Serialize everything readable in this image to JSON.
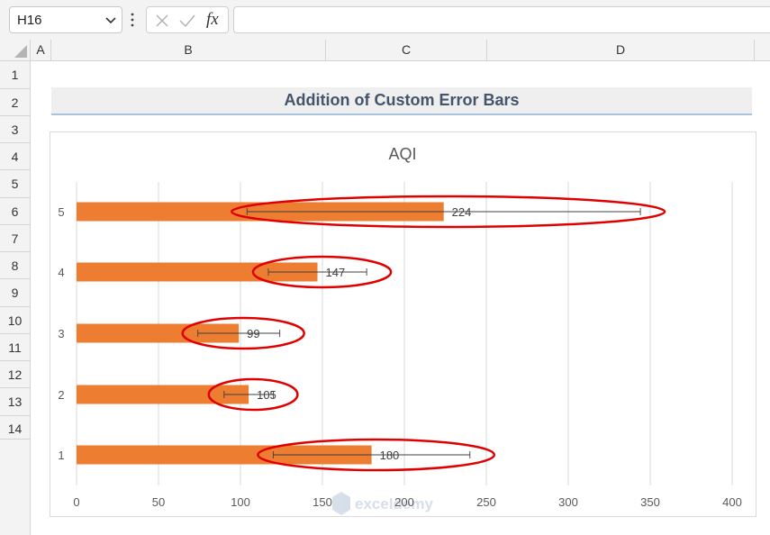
{
  "formula_bar": {
    "name_box": "H16",
    "formula": "",
    "cancel_icon": "x-icon",
    "enter_icon": "check-icon",
    "fx_label": "fx"
  },
  "columns": [
    "A",
    "B",
    "C",
    "D"
  ],
  "rows": [
    "1",
    "2",
    "3",
    "4",
    "5",
    "6",
    "7",
    "8",
    "9",
    "10",
    "11",
    "12",
    "13",
    "14"
  ],
  "sheet": {
    "title": "Addition of Custom Error Bars"
  },
  "colors": {
    "bar": "#ed7d31",
    "highlight": "#e00000",
    "gridline": "#d9d9d9",
    "title_text": "#44546a"
  },
  "chart_data": {
    "type": "bar",
    "orientation": "horizontal",
    "title": "AQI",
    "categories": [
      "1",
      "2",
      "3",
      "4",
      "5"
    ],
    "values": [
      180,
      105,
      99,
      147,
      224
    ],
    "error_bars": [
      {
        "minus": 60,
        "plus": 60
      },
      {
        "minus": 15,
        "plus": 15
      },
      {
        "minus": 25,
        "plus": 25
      },
      {
        "minus": 30,
        "plus": 30
      },
      {
        "minus": 120,
        "plus": 120
      }
    ],
    "data_labels": [
      "180",
      "105",
      "99",
      "147",
      "224"
    ],
    "xlim": [
      0,
      400
    ],
    "x_ticks": [
      "0",
      "50",
      "100",
      "150",
      "200",
      "250",
      "300",
      "350",
      "400"
    ],
    "grid": true,
    "legend": "none",
    "annotations": "red ellipses around each error bar"
  },
  "watermark": "exceldemy"
}
